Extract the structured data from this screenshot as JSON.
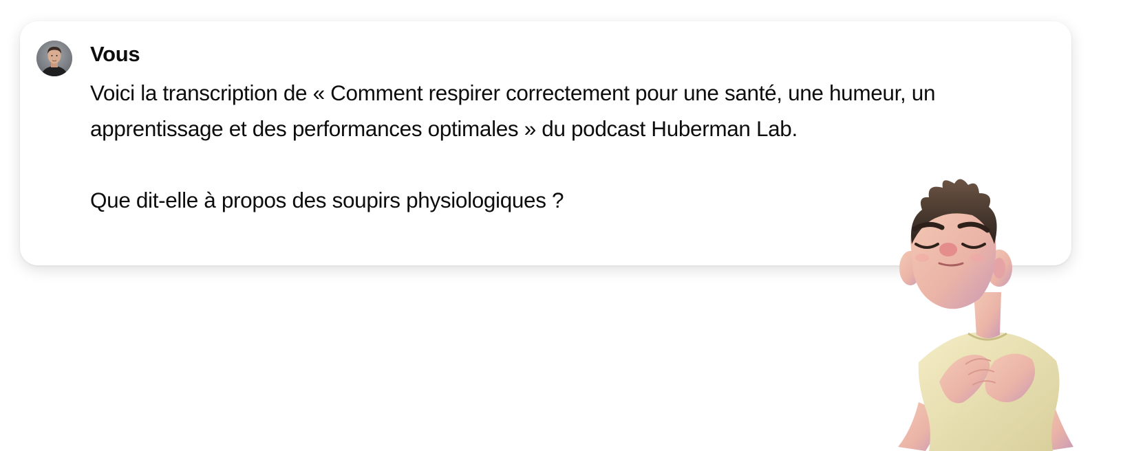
{
  "message": {
    "author": "Vous",
    "avatar_icon": "user-avatar-photo",
    "paragraphs": [
      "Voici la transcription de « Comment respirer correctement pour une santé, une humeur, un apprentissage et des performances optimales » du podcast Huberman Lab.",
      "Que dit-elle à propos des soupirs physiologiques ?"
    ]
  },
  "illustration": {
    "icon": "breathing-cartoon-boy-illustration"
  },
  "colors": {
    "background": "#ffffff",
    "text": "#0d0d0d",
    "card": "#ffffff"
  }
}
